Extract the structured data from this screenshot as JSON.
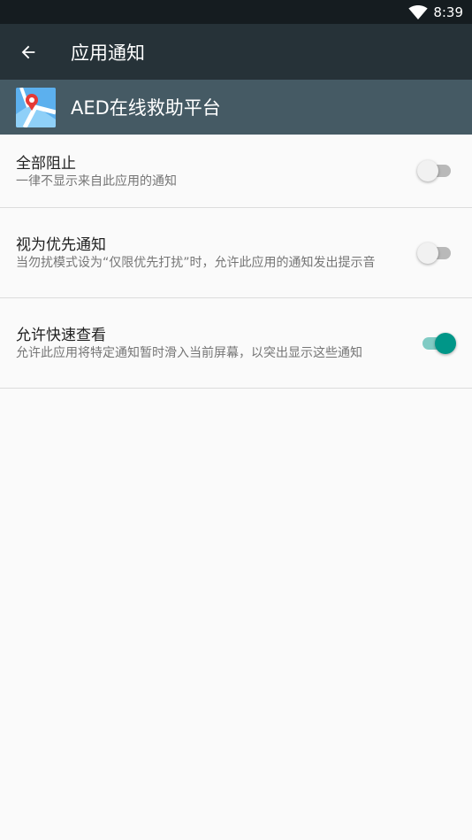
{
  "status_bar": {
    "time": "8:39"
  },
  "app_bar": {
    "title": "应用通知"
  },
  "app_header": {
    "name": "AED在线救助平台"
  },
  "settings": [
    {
      "label": "全部阻止",
      "description": "一律不显示来自此应用的通知",
      "enabled": false
    },
    {
      "label": "视为优先通知",
      "description": "当勿扰模式设为“仅限优先打扰”时，允许此应用的通知发出提示音",
      "enabled": false
    },
    {
      "label": "允许快速查看",
      "description": "允许此应用将特定通知暂时滑入当前屏幕，以突出显示这些通知",
      "enabled": true
    }
  ],
  "colors": {
    "status_bar": "#151c20",
    "app_bar": "#263238",
    "app_header": "#455a64",
    "accent": "#009688"
  }
}
